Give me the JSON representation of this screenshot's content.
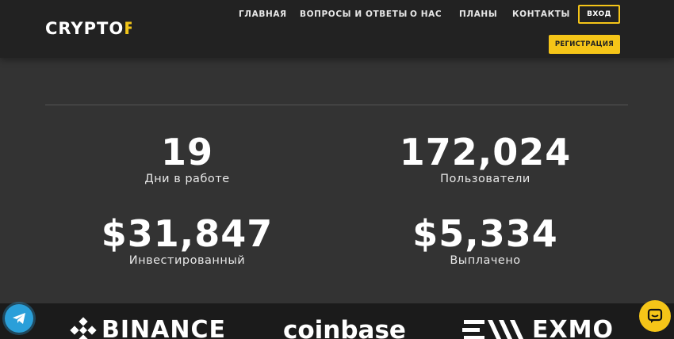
{
  "header": {
    "logo_main": "CRYPTO",
    "logo_accent": "F..",
    "nav": [
      "ГЛАВНАЯ",
      "ВОПРОСЫ И ОТВЕТЫ",
      "О НАС",
      "ПЛАНЫ",
      "КОНТАКТЫ"
    ],
    "login_label": "ВХОД",
    "register_label": "РЕГИСТРАЦИЯ"
  },
  "stats": [
    {
      "value": "19",
      "label": "Дни в работе"
    },
    {
      "value": "172,024",
      "label": "Пользователи"
    },
    {
      "value": "$31,847",
      "label": "Инвестированный"
    },
    {
      "value": "$5,334",
      "label": "Выплачено"
    }
  ],
  "partners": [
    {
      "name": "BINANCE",
      "icon": "binance-icon"
    },
    {
      "name": "coinbase",
      "icon": ""
    },
    {
      "name": "EXMO",
      "icon": "exmo-icon"
    }
  ],
  "colors": {
    "accent": "#f5c518",
    "header_bg": "#222222",
    "page_bg": "#333333",
    "telegram": "#2a9fd9"
  },
  "widgets": {
    "telegram_icon": "telegram-icon",
    "chat_icon": "chat-bubble-icon"
  }
}
